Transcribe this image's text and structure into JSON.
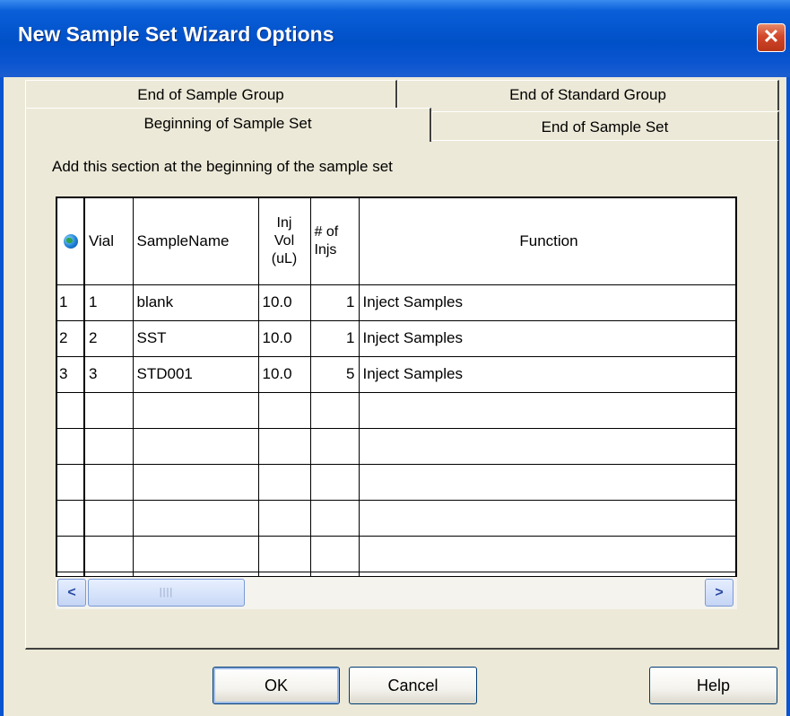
{
  "window": {
    "title": "New Sample Set Wizard Options",
    "close_glyph": "✕"
  },
  "tabs": {
    "back_row": [
      "End of Sample Group",
      "End of Standard Group"
    ],
    "front_row": [
      "Beginning of Sample Set",
      "End of Sample Set"
    ],
    "active": "Beginning of Sample Set"
  },
  "panel": {
    "instruction": "Add this section at the beginning of the sample set"
  },
  "grid": {
    "corner_icon": "globe-icon",
    "headers": {
      "vial": "Vial",
      "sample_name": "SampleName",
      "inj_vol": [
        "Inj",
        "Vol",
        "(uL)"
      ],
      "num_injs": [
        "# of",
        "Injs"
      ],
      "function": "Function"
    },
    "rows": [
      {
        "n": "1",
        "vial": "1",
        "name": "blank",
        "vol": "10.0",
        "injs": "1",
        "function": "Inject Samples"
      },
      {
        "n": "2",
        "vial": "2",
        "name": "SST",
        "vol": "10.0",
        "injs": "1",
        "function": "Inject Samples"
      },
      {
        "n": "3",
        "vial": "3",
        "name": "STD001",
        "vol": "10.0",
        "injs": "5",
        "function": "Inject Samples"
      }
    ],
    "scrollbar": {
      "left_glyph": "<",
      "right_glyph": ">",
      "thumb_grip": "||||"
    }
  },
  "buttons": {
    "ok": "OK",
    "cancel": "Cancel",
    "help": "Help"
  }
}
